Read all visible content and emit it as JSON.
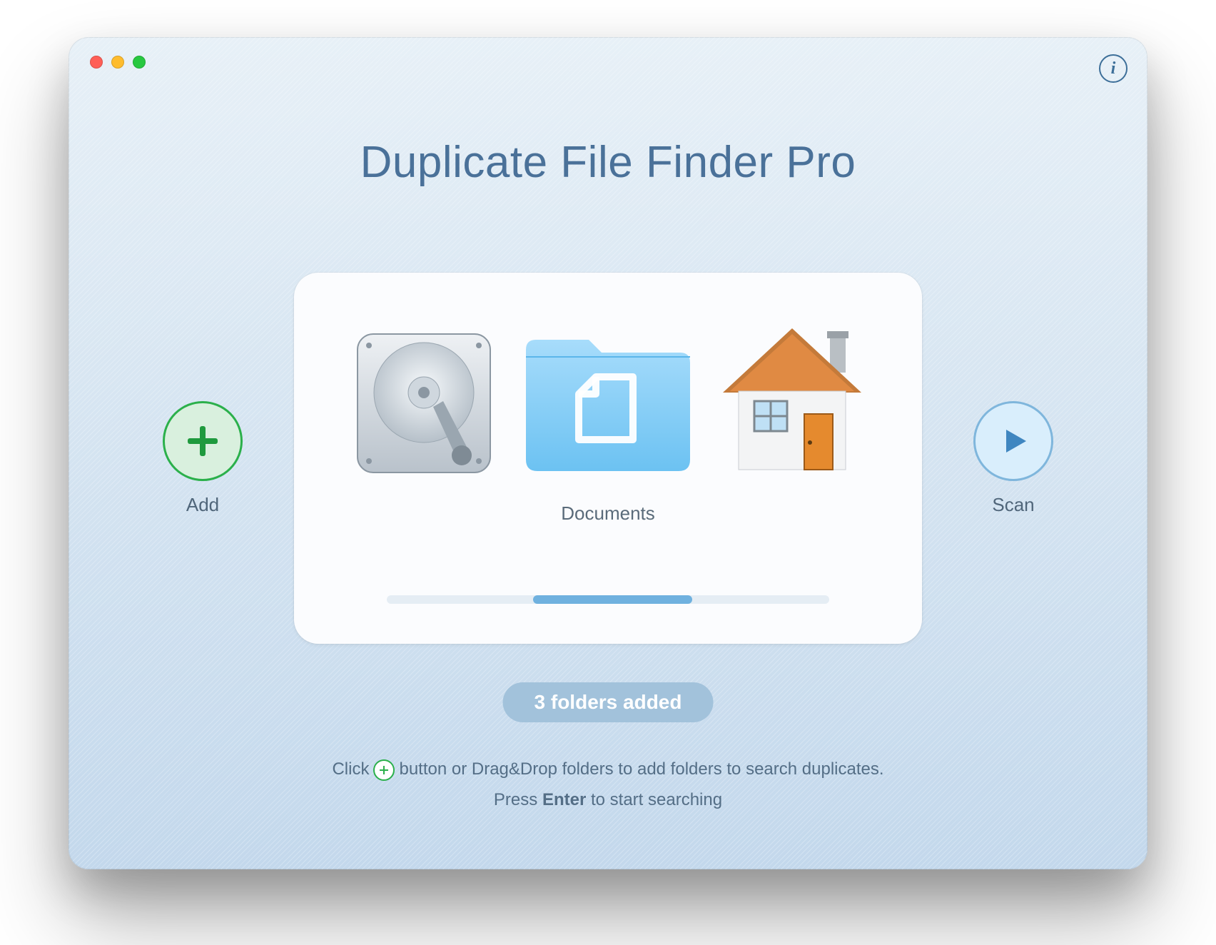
{
  "app": {
    "title": "Duplicate File Finder Pro"
  },
  "buttons": {
    "add_label": "Add",
    "scan_label": "Scan"
  },
  "drop_area": {
    "items": [
      {
        "icon": "hard-drive-icon",
        "label": ""
      },
      {
        "icon": "documents-folder-icon",
        "label": "Documents"
      },
      {
        "icon": "home-folder-icon",
        "label": ""
      }
    ],
    "selected_label": "Documents"
  },
  "status": {
    "folders_added_text": "3 folders added",
    "folder_count": 3
  },
  "hints": {
    "line1_before": "Click",
    "line1_after": "button or Drag&Drop folders to add folders to search duplicates.",
    "line2_before": "Press",
    "line2_bold": "Enter",
    "line2_after": "to start searching"
  },
  "colors": {
    "accent_green": "#2bb04b",
    "accent_blue": "#6fb1df",
    "title_blue": "#4a7199"
  }
}
